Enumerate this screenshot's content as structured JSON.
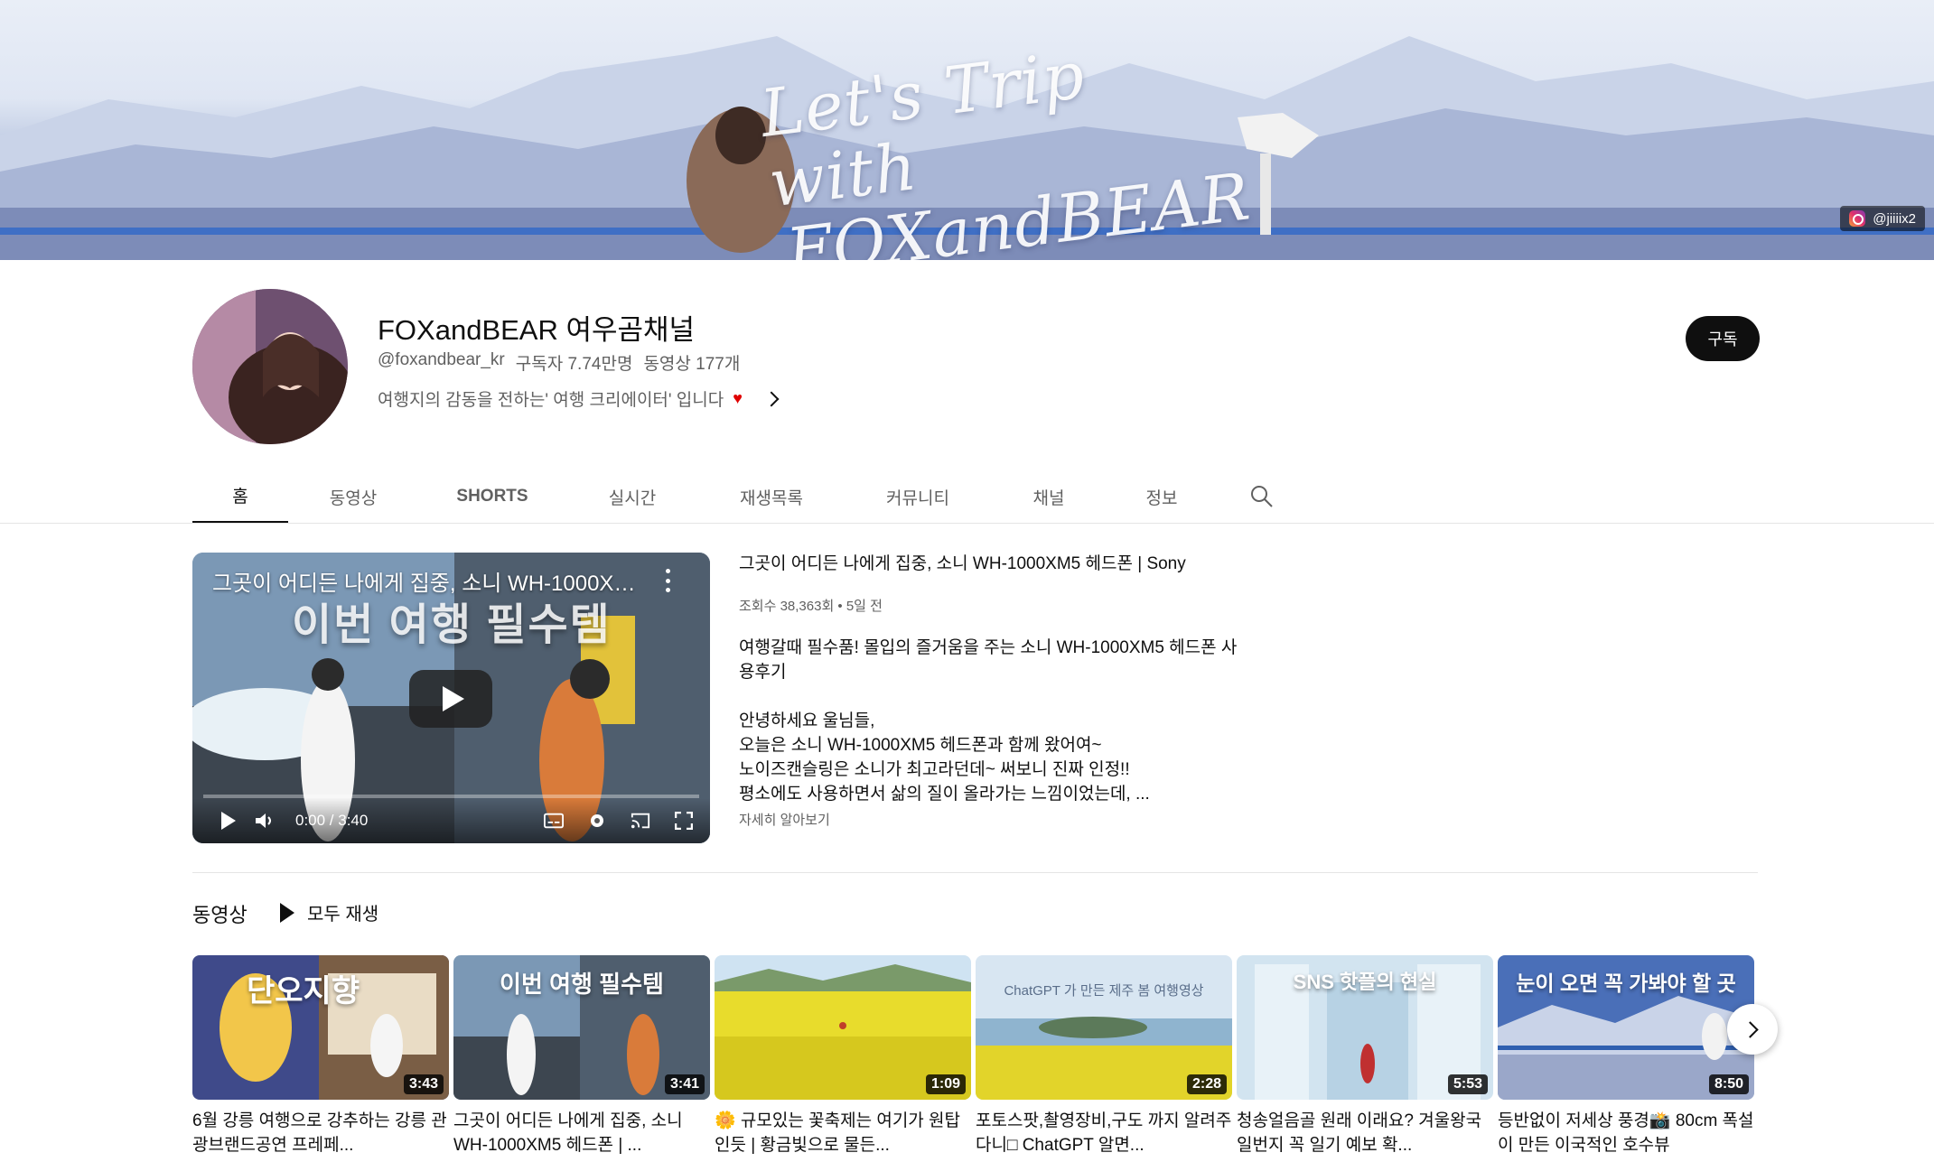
{
  "banner": {
    "title_line1": "Let's Trip with",
    "title_line2": "FOXandBEAR",
    "instagram_handle": "@jiiiix2"
  },
  "channel": {
    "name": "FOXandBEAR 여우곰채널",
    "handle": "@foxandbear_kr",
    "subscribers": "구독자 7.74만명",
    "video_count": "동영상 177개",
    "description": "여행지의 감동을 전하는' 여행 크리에이터' 입니다",
    "subscribe_label": "구독"
  },
  "tabs": [
    {
      "label": "홈"
    },
    {
      "label": "동영상"
    },
    {
      "label": "SHORTS"
    },
    {
      "label": "실시간"
    },
    {
      "label": "재생목록"
    },
    {
      "label": "커뮤니티"
    },
    {
      "label": "채널"
    },
    {
      "label": "정보"
    }
  ],
  "featured": {
    "player_title": "그곳이 어디든 나에게 집중, 소니 WH-1000XM5 헤드폰 | Sony",
    "thumbnail_text": "이번 여행 필수템",
    "time": "0:00 / 3:40",
    "title": "그곳이 어디든 나에게 집중, 소니 WH-1000XM5 헤드폰 | Sony",
    "meta": "조회수 38,363회 • 5일 전",
    "desc_line1": "여행갈때 필수품! 몰입의 즐거움을 주는 소니 WH-1000XM5 헤드폰 사용후기",
    "desc_line2": "안녕하세요 울님들,",
    "desc_line3": "오늘은 소니 WH-1000XM5 헤드폰과 함께 왔어여~",
    "desc_line4": "노이즈캔슬링은 소니가 최고라던데~ 써보니 진짜 인정!!",
    "desc_line5": "평소에도 사용하면서 삶의 질이 올라가는 느낌이었는데, ...",
    "more": "자세히 알아보기"
  },
  "shelf": {
    "title": "동영상",
    "play_all": "모두 재생",
    "videos": [
      {
        "title": "6월 강릉 여행으로 강추하는 강릉 관광브랜드공연 프레페...",
        "duration": "3:43",
        "thumb_text": "단오지향"
      },
      {
        "title": "그곳이 어디든 나에게 집중, 소니 WH-1000XM5 헤드폰 | ...",
        "duration": "3:41",
        "thumb_text": "이번 여행 필수템"
      },
      {
        "title": "🌼 규모있는 꽃축제는 여기가 원탑인듯 | 황금빛으로 물든...",
        "duration": "1:09",
        "thumb_text": ""
      },
      {
        "title": "포토스팟,촬영장비,구도 까지 알려주다니□ ChatGPT 알면...",
        "duration": "2:28",
        "thumb_text": "ChatGPT 가 만든 제주 봄 여행영상"
      },
      {
        "title": "청송얼음골 원래 이래요? 겨울왕국 일번지 꼭 일기 예보 확...",
        "duration": "5:53",
        "thumb_text": "SNS 핫플의 현실"
      },
      {
        "title": "등반없이 저세상 풍경📸 80cm 폭설이 만든 이국적인 호수뷰",
        "duration": "8:50",
        "thumb_text": "눈이 오면 꼭 가봐야 할 곳"
      }
    ]
  },
  "colors": {
    "accent": "#0f0f0f",
    "secondary_text": "#606060",
    "heart": "#e00000"
  }
}
